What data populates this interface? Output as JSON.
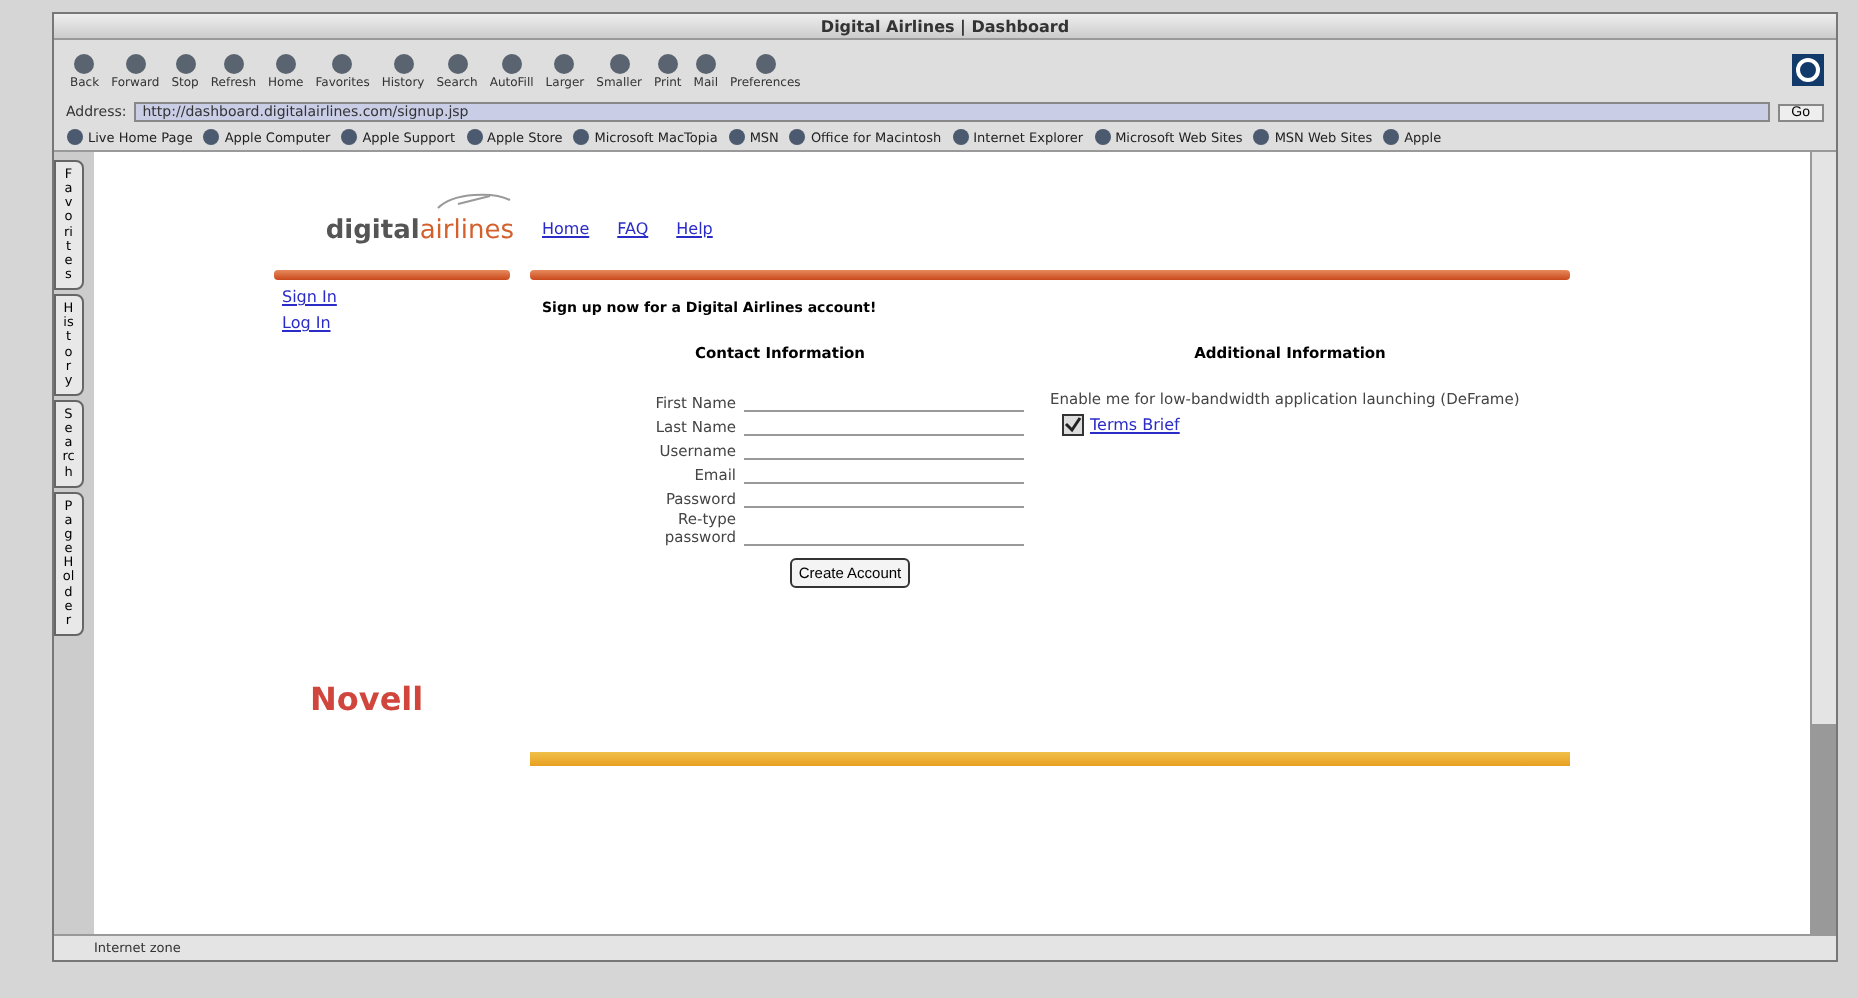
{
  "window": {
    "title": "Digital Airlines | Dashboard"
  },
  "toolbar": [
    "Back",
    "Forward",
    "Stop",
    "Refresh",
    "Home",
    "Favorites",
    "History",
    "Search",
    "AutoFill",
    "Larger",
    "Smaller",
    "Print",
    "Mail",
    "Preferences"
  ],
  "address": {
    "label": "Address:",
    "value": "http://dashboard.digitalairlines.com/signup.jsp",
    "go": "Go"
  },
  "favorites": [
    "Live Home Page",
    "Apple Computer",
    "Apple Support",
    "Apple Store",
    "Microsoft MacTopia",
    "MSN",
    "Office for Macintosh",
    "Internet Explorer",
    "Microsoft Web Sites",
    "MSN Web Sites",
    "Apple"
  ],
  "side_tabs": [
    "Favorites",
    "History",
    "Search",
    "Page Holder"
  ],
  "page": {
    "logo": {
      "first": "digital",
      "second": "airlines"
    },
    "nav": [
      "Home",
      "FAQ",
      "Help"
    ],
    "side_links": [
      "Sign In",
      "Log In"
    ],
    "heading": "Sign up now for a Digital Airlines account!",
    "contact": {
      "title": "Contact Information",
      "fields": [
        {
          "label": "First Name"
        },
        {
          "label": "Last Name"
        },
        {
          "label": "Username"
        },
        {
          "label": "Email"
        },
        {
          "label": "Password"
        },
        {
          "label": "Re-type password"
        }
      ],
      "button": "Create Account"
    },
    "additional": {
      "title": "Additional Information",
      "text": "Enable me for low-bandwidth application launching (DeFrame)",
      "option": {
        "label": "Terms Brief",
        "checked": true
      }
    },
    "footer_logo": "Novell"
  },
  "status_bar": "Internet zone"
}
